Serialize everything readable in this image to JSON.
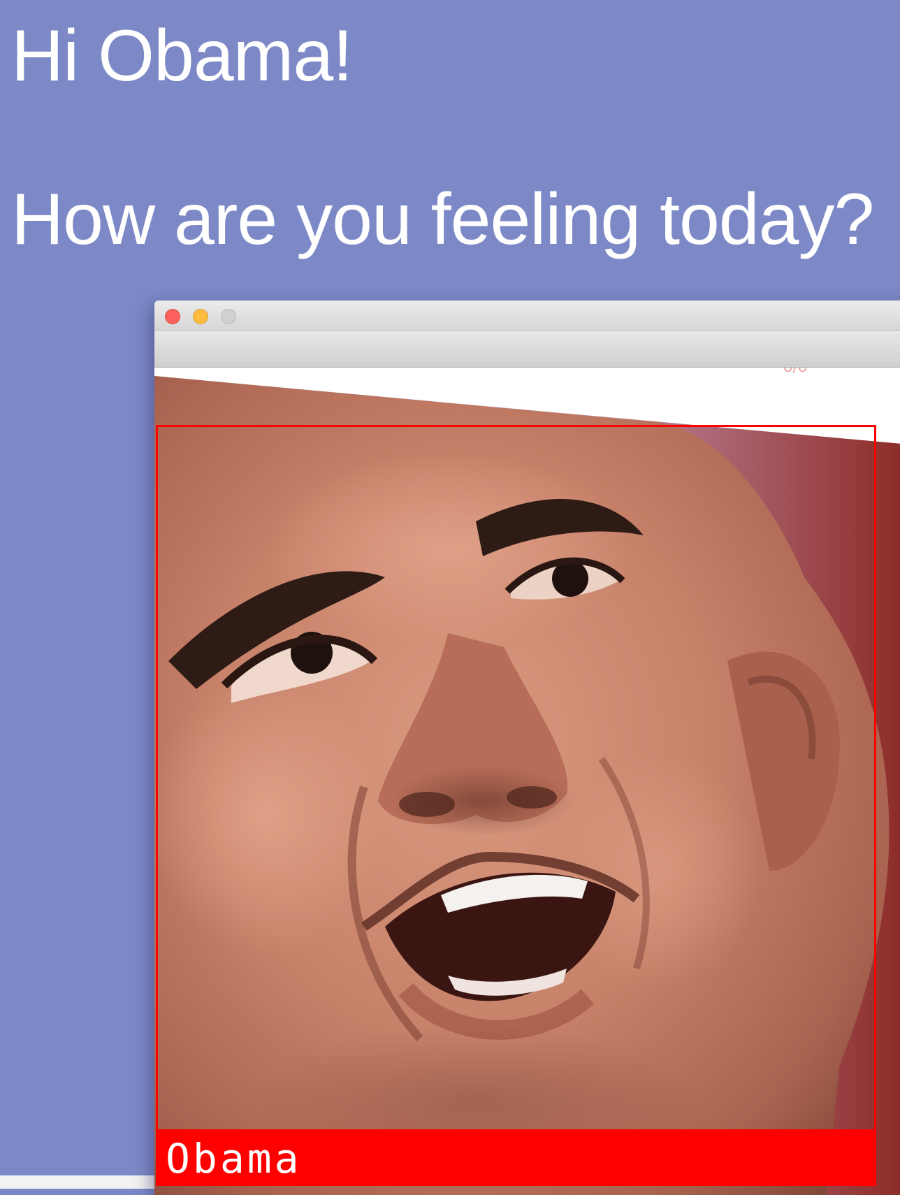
{
  "page": {
    "background_color": "#7d89c7"
  },
  "greeting": {
    "line1": "Hi Obama!",
    "line2": "How are you feeling today?"
  },
  "window": {
    "traffic_lights": [
      "close",
      "minimize",
      "zoom"
    ],
    "detection": {
      "box_color": "#ff0000",
      "label": "Obama"
    }
  }
}
